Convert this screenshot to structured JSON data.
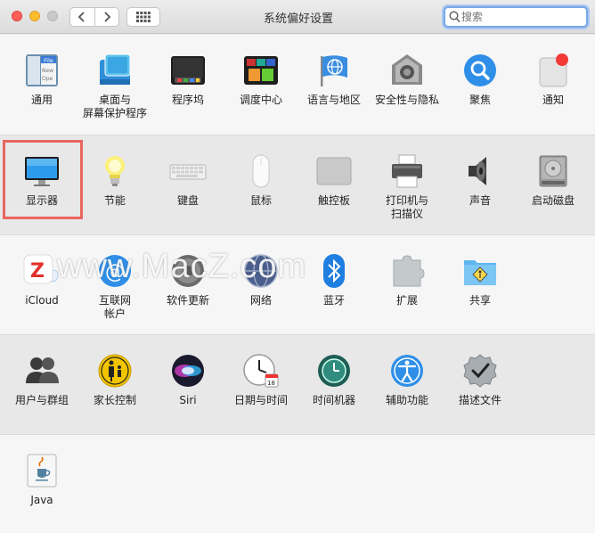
{
  "window": {
    "title": "系统偏好设置"
  },
  "toolbar": {
    "back_icon": "chevron-left-icon",
    "forward_icon": "chevron-right-icon",
    "grid_icon": "grid-icon"
  },
  "search": {
    "placeholder": "搜索",
    "value": ""
  },
  "rows": {
    "r1": [
      {
        "label": "通用",
        "icon": "general-icon"
      },
      {
        "label": "桌面与\n屏幕保护程序",
        "icon": "desktop-screensaver-icon"
      },
      {
        "label": "程序坞",
        "icon": "dock-icon"
      },
      {
        "label": "调度中心",
        "icon": "mission-control-icon"
      },
      {
        "label": "语言与地区",
        "icon": "language-region-icon"
      },
      {
        "label": "安全性与隐私",
        "icon": "security-privacy-icon"
      },
      {
        "label": "聚焦",
        "icon": "spotlight-icon"
      },
      {
        "label": "通知",
        "icon": "notifications-icon"
      }
    ],
    "r2": [
      {
        "label": "显示器",
        "icon": "displays-icon"
      },
      {
        "label": "节能",
        "icon": "energy-saver-icon"
      },
      {
        "label": "键盘",
        "icon": "keyboard-icon"
      },
      {
        "label": "鼠标",
        "icon": "mouse-icon"
      },
      {
        "label": "触控板",
        "icon": "trackpad-icon"
      },
      {
        "label": "打印机与\n扫描仪",
        "icon": "printers-scanners-icon"
      },
      {
        "label": "声音",
        "icon": "sound-icon"
      },
      {
        "label": "启动磁盘",
        "icon": "startup-disk-icon"
      }
    ],
    "r3": [
      {
        "label": "iCloud",
        "icon": "icloud-icon"
      },
      {
        "label": "互联网\n帐户",
        "icon": "internet-accounts-icon"
      },
      {
        "label": "软件更新",
        "icon": "software-update-icon"
      },
      {
        "label": "网络",
        "icon": "network-icon"
      },
      {
        "label": "蓝牙",
        "icon": "bluetooth-icon"
      },
      {
        "label": "扩展",
        "icon": "extensions-icon"
      },
      {
        "label": "共享",
        "icon": "sharing-icon"
      }
    ],
    "r4": [
      {
        "label": "用户与群组",
        "icon": "users-groups-icon"
      },
      {
        "label": "家长控制",
        "icon": "parental-controls-icon"
      },
      {
        "label": "Siri",
        "icon": "siri-icon"
      },
      {
        "label": "日期与时间",
        "icon": "date-time-icon"
      },
      {
        "label": "时间机器",
        "icon": "time-machine-icon"
      },
      {
        "label": "辅助功能",
        "icon": "accessibility-icon"
      },
      {
        "label": "描述文件",
        "icon": "profiles-icon"
      }
    ],
    "r5": [
      {
        "label": "Java",
        "icon": "java-icon"
      }
    ]
  },
  "watermark": {
    "text": "www.MacZ.com",
    "logo_letter": "Z"
  },
  "colors": {
    "highlight": "#e8665e",
    "search_focus": "#7aa7e6"
  }
}
